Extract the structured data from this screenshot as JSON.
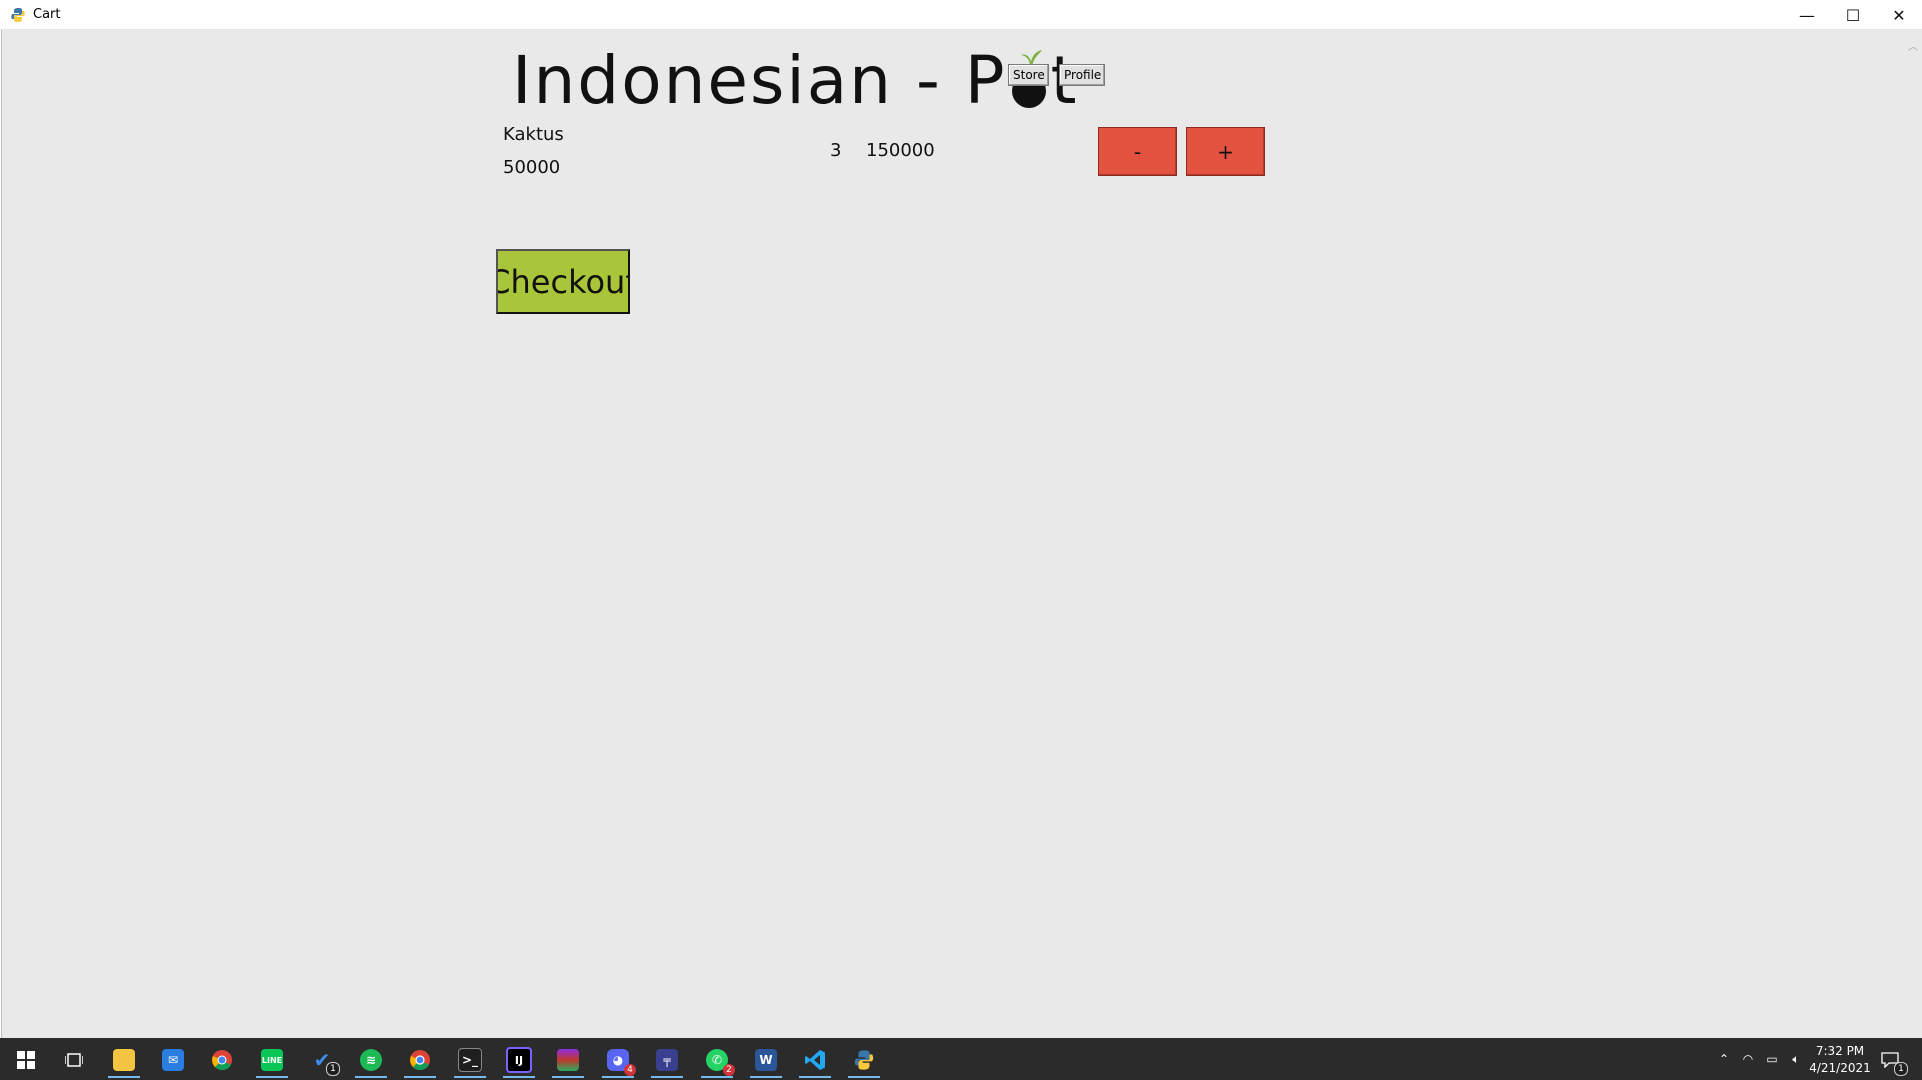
{
  "window": {
    "title": "Cart",
    "controls": {
      "minimize": "—",
      "maximize": "☐",
      "close": "✕"
    }
  },
  "header": {
    "logo_text_left": "Indonesian - P",
    "logo_text_right": "t",
    "store_label": "Store",
    "profile_label": "Profile"
  },
  "cart": {
    "items": [
      {
        "name": "Kaktus",
        "price": "50000",
        "quantity": "3",
        "subtotal": "150000"
      }
    ],
    "decrement_label": "-",
    "increment_label": "+",
    "checkout_label": "Checkout"
  },
  "colors": {
    "content_bg": "#e9e9e9",
    "qty_button": "#e3513f",
    "checkout_button": "#a9c63a",
    "leaf": "#7cb342",
    "taskbar": "#2b2b2b"
  },
  "taskbar": {
    "apps": [
      {
        "name": "start",
        "icon": "windows-logo-icon"
      },
      {
        "name": "task-view",
        "icon": "task-view-icon"
      },
      {
        "name": "file-explorer",
        "icon": "folder-icon",
        "running": true
      },
      {
        "name": "mail",
        "icon": "mail-icon"
      },
      {
        "name": "chrome",
        "icon": "chrome-icon"
      },
      {
        "name": "line",
        "icon": "line-chat-icon",
        "running": true
      },
      {
        "name": "todo",
        "icon": "checkmark-icon",
        "badge": "1"
      },
      {
        "name": "spotify",
        "icon": "spotify-icon",
        "running": true
      },
      {
        "name": "chrome-profile",
        "icon": "chrome-profile-icon",
        "running": true
      },
      {
        "name": "terminal",
        "icon": "terminal-icon",
        "running": true
      },
      {
        "name": "intellij",
        "icon": "intellij-icon",
        "running": true
      },
      {
        "name": "winrar",
        "icon": "archive-icon",
        "running": true
      },
      {
        "name": "discord",
        "icon": "discord-icon",
        "badge": "4",
        "running": true
      },
      {
        "name": "trello",
        "icon": "board-icon",
        "running": true
      },
      {
        "name": "whatsapp",
        "icon": "whatsapp-icon",
        "badge": "2",
        "running": true
      },
      {
        "name": "word",
        "icon": "word-icon",
        "running": true
      },
      {
        "name": "vscode",
        "icon": "vscode-icon",
        "running": true
      },
      {
        "name": "python",
        "icon": "python-icon",
        "running": true
      }
    ],
    "tray": {
      "time": "7:32 PM",
      "date": "4/21/2021",
      "notification_count": "1"
    }
  }
}
